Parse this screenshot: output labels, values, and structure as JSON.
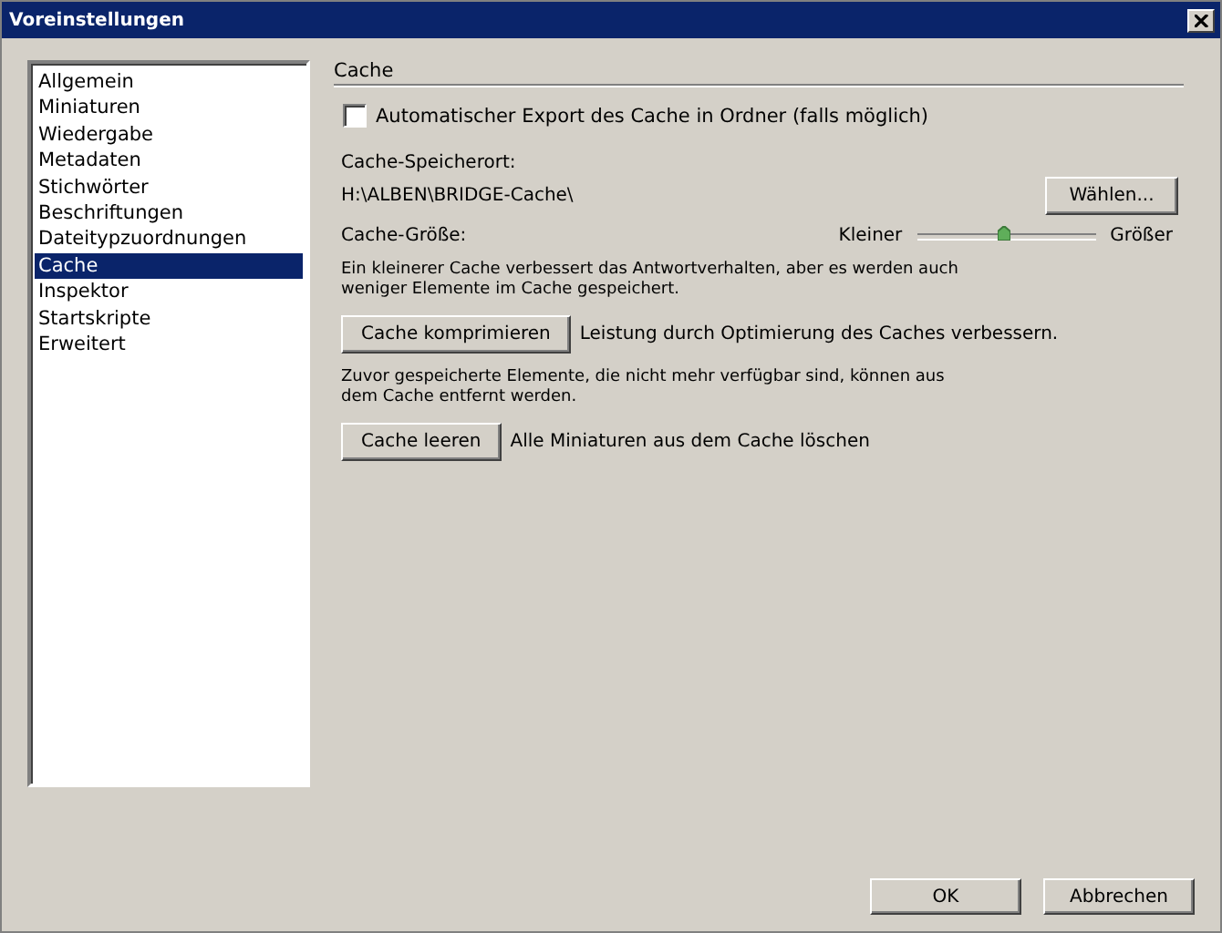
{
  "window": {
    "title": "Voreinstellungen"
  },
  "sidebar": {
    "items": [
      {
        "label": "Allgemein",
        "selected": false
      },
      {
        "label": "Miniaturen",
        "selected": false
      },
      {
        "label": "Wiedergabe",
        "selected": false
      },
      {
        "label": "Metadaten",
        "selected": false
      },
      {
        "label": "Stichwörter",
        "selected": false
      },
      {
        "label": "Beschriftungen",
        "selected": false
      },
      {
        "label": "Dateitypzuordnungen",
        "selected": false
      },
      {
        "label": "Cache",
        "selected": true
      },
      {
        "label": "Inspektor",
        "selected": false
      },
      {
        "label": "Startskripte",
        "selected": false
      },
      {
        "label": "Erweitert",
        "selected": false
      }
    ]
  },
  "section": {
    "title": "Cache",
    "auto_export": {
      "label": "Automatischer Export des Cache in Ordner (falls möglich)",
      "checked": false
    },
    "location_label": "Cache-Speicherort:",
    "location_path": "H:\\ALBEN\\BRIDGE-Cache\\",
    "choose_button": "Wählen...",
    "size_label": "Cache-Größe:",
    "size_slider": {
      "min_label": "Kleiner",
      "max_label": "Größer",
      "level": 0.48
    },
    "size_note": "Ein kleinerer Cache verbessert das Antwortverhalten, aber es werden auch weniger Elemente im Cache gespeichert.",
    "compress_button": "Cache komprimieren",
    "compress_note": "Leistung durch Optimierung des Caches verbessern.",
    "compact_note": "Zuvor gespeicherte Elemente, die nicht mehr verfügbar sind, können aus dem Cache entfernt werden.",
    "clear_button": "Cache leeren",
    "clear_note": "Alle Miniaturen aus dem Cache löschen"
  },
  "buttons": [
    "OK",
    "Abbrechen"
  ]
}
